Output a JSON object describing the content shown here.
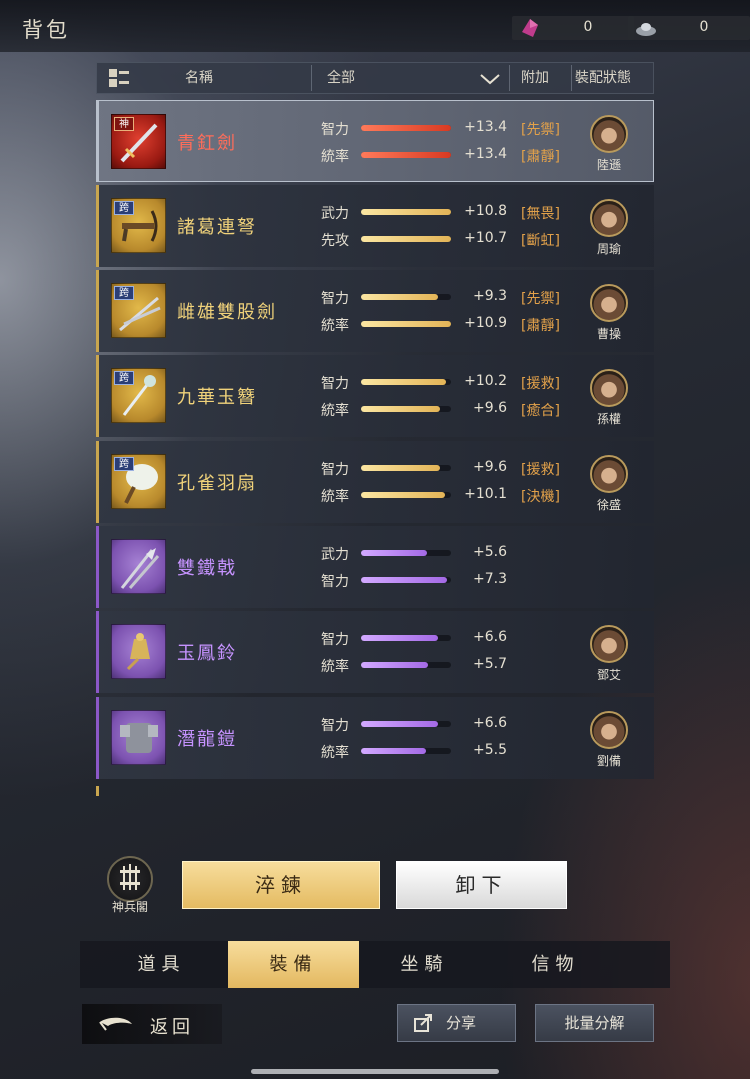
{
  "title": "背包",
  "currencies": [
    {
      "icon": "purple-crystal-icon",
      "value": "0"
    },
    {
      "icon": "silver-ingot-icon",
      "value": "0"
    }
  ],
  "header": {
    "name_label": "名稱",
    "filter_value": "全部",
    "extra_label": "附加",
    "status_label": "裝配狀態"
  },
  "items": [
    {
      "name": "青釭劍",
      "tag": "神",
      "tier": "red",
      "icon": "sword-icon",
      "stats": [
        {
          "label": "智力",
          "value": "+13.4",
          "fill": 1.0
        },
        {
          "label": "統率",
          "value": "+13.4",
          "fill": 1.0
        }
      ],
      "bonus": [
        "[先禦]",
        "[肅靜]"
      ],
      "hero": "陸遜",
      "selected": true
    },
    {
      "name": "諸葛連弩",
      "tag": "跨",
      "tier": "gold",
      "icon": "crossbow-icon",
      "stats": [
        {
          "label": "武力",
          "value": "+10.8",
          "fill": 1.0
        },
        {
          "label": "先攻",
          "value": "+10.7",
          "fill": 1.0
        }
      ],
      "bonus": [
        "[無畏]",
        "[斷虹]"
      ],
      "hero": "周瑜"
    },
    {
      "name": "雌雄雙股劍",
      "tag": "跨",
      "tier": "gold",
      "icon": "twin-swords-icon",
      "stats": [
        {
          "label": "智力",
          "value": "+9.3",
          "fill": 0.85
        },
        {
          "label": "統率",
          "value": "+10.9",
          "fill": 1.0
        }
      ],
      "bonus": [
        "[先禦]",
        "[肅靜]"
      ],
      "hero": "曹操"
    },
    {
      "name": "九華玉簪",
      "tag": "跨",
      "tier": "gold",
      "icon": "jade-hairpin-icon",
      "stats": [
        {
          "label": "智力",
          "value": "+10.2",
          "fill": 0.94
        },
        {
          "label": "統率",
          "value": "+9.6",
          "fill": 0.88
        }
      ],
      "bonus": [
        "[援救]",
        "[癒合]"
      ],
      "hero": "孫權"
    },
    {
      "name": "孔雀羽扇",
      "tag": "跨",
      "tier": "gold",
      "icon": "feather-fan-icon",
      "stats": [
        {
          "label": "智力",
          "value": "+9.6",
          "fill": 0.88
        },
        {
          "label": "統率",
          "value": "+10.1",
          "fill": 0.93
        }
      ],
      "bonus": [
        "[援救]",
        "[決機]"
      ],
      "hero": "徐盛"
    },
    {
      "name": "雙鐵戟",
      "tag": "",
      "tier": "purple",
      "icon": "halberd-icon",
      "stats": [
        {
          "label": "武力",
          "value": "+5.6",
          "fill": 0.73
        },
        {
          "label": "智力",
          "value": "+7.3",
          "fill": 0.95
        }
      ],
      "bonus": [
        "",
        ""
      ],
      "hero": ""
    },
    {
      "name": "玉鳳鈴",
      "tag": "",
      "tier": "purple",
      "icon": "bell-icon",
      "stats": [
        {
          "label": "智力",
          "value": "+6.6",
          "fill": 0.86
        },
        {
          "label": "統率",
          "value": "+5.7",
          "fill": 0.74
        }
      ],
      "bonus": [
        "",
        ""
      ],
      "hero": "鄧艾"
    },
    {
      "name": "潛龍鎧",
      "tag": "",
      "tier": "purple",
      "icon": "armor-icon",
      "stats": [
        {
          "label": "智力",
          "value": "+6.6",
          "fill": 0.86
        },
        {
          "label": "統率",
          "value": "+5.5",
          "fill": 0.72
        }
      ],
      "bonus": [
        "",
        ""
      ],
      "hero": "劉備"
    }
  ],
  "side_button_label": "神兵閣",
  "actions": {
    "refine": "淬鍊",
    "unequip": "卸下"
  },
  "tabs": [
    "道具",
    "裝備",
    "坐騎",
    "信物"
  ],
  "active_tab": 1,
  "back_label": "返回",
  "share_label": "分享",
  "batch_label": "批量分解",
  "colors": {
    "gold": "#e3b860",
    "red": "#d83a22",
    "purple": "#a46ae6",
    "bonus": "#e2a14a"
  }
}
